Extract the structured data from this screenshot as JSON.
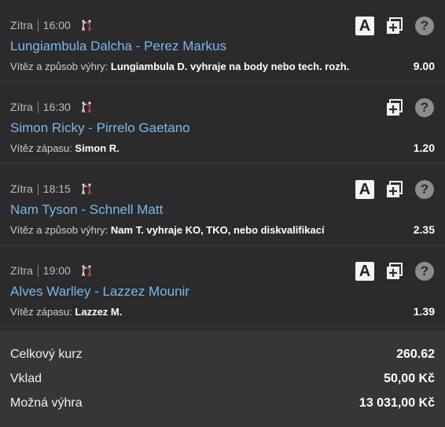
{
  "bets": [
    {
      "day": "Zítra",
      "time": "16:00",
      "sport_icon": "mma-fighters-icon",
      "title": "Lungiambula Dalcha - Perez Markus",
      "market": "Vítěz a způsob výhry:",
      "selection": "Lungiambula D. vyhraje na body nebo tech. rozh.",
      "odd": "9.00",
      "has_a": true,
      "a_label": "A"
    },
    {
      "day": "Zítra",
      "time": "16:30",
      "sport_icon": "mma-fighters-icon",
      "title": "Simon Ricky - Pirrelo Gaetano",
      "market": "Vítěz zápasu:",
      "selection": "Simon R.",
      "odd": "1.20",
      "has_a": false,
      "a_label": ""
    },
    {
      "day": "Zítra",
      "time": "18:15",
      "sport_icon": "mma-fighters-icon",
      "title": "Nam Tyson - Schnell Matt",
      "market": "Vítěz a způsob výhry:",
      "selection": "Nam T. vyhraje KO, TKO, nebo diskvalifikací",
      "odd": "2.35",
      "has_a": true,
      "a_label": "A"
    },
    {
      "day": "Zítra",
      "time": "19:00",
      "sport_icon": "mma-fighters-icon",
      "title": "Alves Warlley - Lazzez Mounir",
      "market": "Vítěz zápasu:",
      "selection": "Lazzez M.",
      "odd": "1.39",
      "has_a": true,
      "a_label": "A"
    }
  ],
  "help_label": "?",
  "summary": {
    "total_odds_label": "Celkový kurz",
    "total_odds": "260.62",
    "stake_label": "Vklad",
    "stake": "50,00 Kč",
    "win_label": "Možná výhra",
    "win": "13 031,00 Kč"
  },
  "colors": {
    "background": "#2b2b2b",
    "title": "#79b7ef",
    "summary_bg": "#363636"
  }
}
